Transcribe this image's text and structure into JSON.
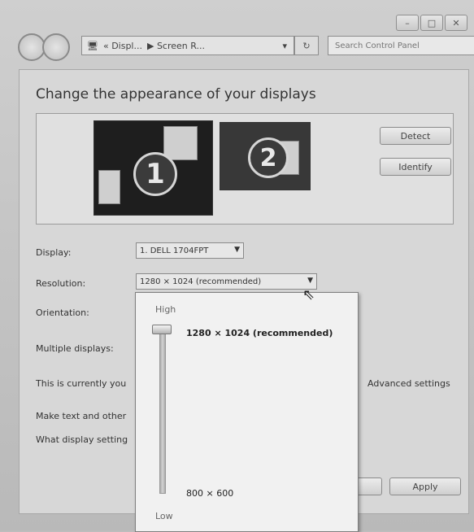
{
  "window": {
    "caption_buttons": [
      "–",
      "□",
      "✕"
    ]
  },
  "navbar": {
    "breadcrumb": [
      "« Displ...",
      "▶ Screen R..."
    ],
    "dropdown_glyph": "▾",
    "refresh_glyph": "↻",
    "search_placeholder": "Search Control Panel",
    "search_icon": "⌕"
  },
  "main": {
    "heading": "Change the appearance of your displays",
    "monitors": [
      {
        "number": "1"
      },
      {
        "number": "2"
      }
    ],
    "buttons": {
      "detect": "Detect",
      "identify": "Identify",
      "apply": "Apply"
    },
    "fields": {
      "display_label": "Display:",
      "display_value": "1. DELL 1704FPT",
      "resolution_label": "Resolution:",
      "resolution_value": "1280 × 1024 (recommended)",
      "orientation_label": "Orientation:",
      "multiple_label": "Multiple displays:"
    },
    "links": {
      "current": "This is currently you",
      "advanced": "Advanced settings",
      "make_text": "Make text and other",
      "what_settings": "What display setting"
    }
  },
  "resolution_dropdown": {
    "high": "High",
    "low": "Low",
    "selected": "1280 × 1024 (recommended)",
    "min": "800 × 600",
    "slider_position": 1.0
  }
}
